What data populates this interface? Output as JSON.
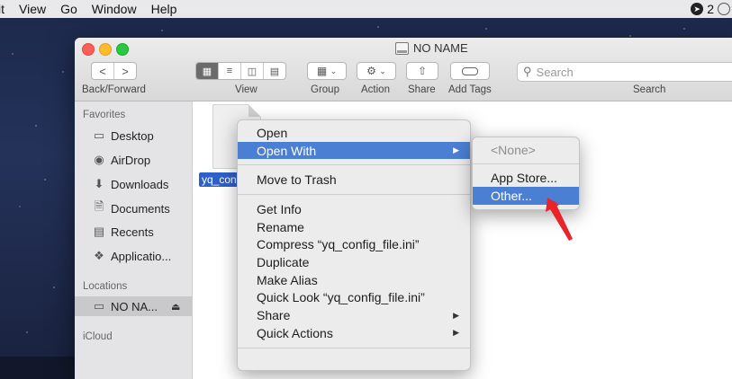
{
  "menubar": {
    "items": [
      "it",
      "View",
      "Go",
      "Window",
      "Help"
    ],
    "tray_badge": "2"
  },
  "window": {
    "title": "NO NAME",
    "toolbar": {
      "back_label": "<",
      "forward_label": ">",
      "back_forward_caption": "Back/Forward",
      "view_caption": "View",
      "group_caption": "Group",
      "action_caption": "Action",
      "share_caption": "Share",
      "add_tags_caption": "Add Tags",
      "search_caption": "Search",
      "search_placeholder": "Search"
    },
    "sidebar": {
      "favorites_header": "Favorites",
      "favorites": [
        {
          "label": "Desktop",
          "icon": "desktop-icon"
        },
        {
          "label": "AirDrop",
          "icon": "airdrop-icon"
        },
        {
          "label": "Downloads",
          "icon": "downloads-icon"
        },
        {
          "label": "Documents",
          "icon": "documents-icon"
        },
        {
          "label": "Recents",
          "icon": "recents-icon"
        },
        {
          "label": "Applicatio...",
          "icon": "applications-icon"
        }
      ],
      "locations_header": "Locations",
      "locations": [
        {
          "label": "NO NA...",
          "icon": "disk-icon",
          "selected": true
        }
      ],
      "icloud_header": "iCloud"
    },
    "file": {
      "label": "yq_con"
    }
  },
  "context_menu": {
    "items": [
      {
        "label": "Open"
      },
      {
        "label": "Open With",
        "submenu": true,
        "highlighted": true
      },
      {
        "separator": true
      },
      {
        "label": "Move to Trash"
      },
      {
        "separator": true
      },
      {
        "label": "Get Info"
      },
      {
        "label": "Rename"
      },
      {
        "label": "Compress “yq_config_file.ini”"
      },
      {
        "label": "Duplicate"
      },
      {
        "label": "Make Alias"
      },
      {
        "label": "Quick Look “yq_config_file.ini”"
      },
      {
        "label": "Share",
        "submenu": true
      },
      {
        "label": "Quick Actions",
        "submenu": true
      }
    ]
  },
  "open_with_submenu": {
    "items": [
      {
        "label": "<None>",
        "disabled": true
      },
      {
        "label": "App Store..."
      },
      {
        "label": "Other...",
        "highlighted": true
      }
    ]
  },
  "colors": {
    "highlight": "#4b7fd3",
    "file_selection": "#2d60c8",
    "pointer_arrow": "#e8232a"
  }
}
